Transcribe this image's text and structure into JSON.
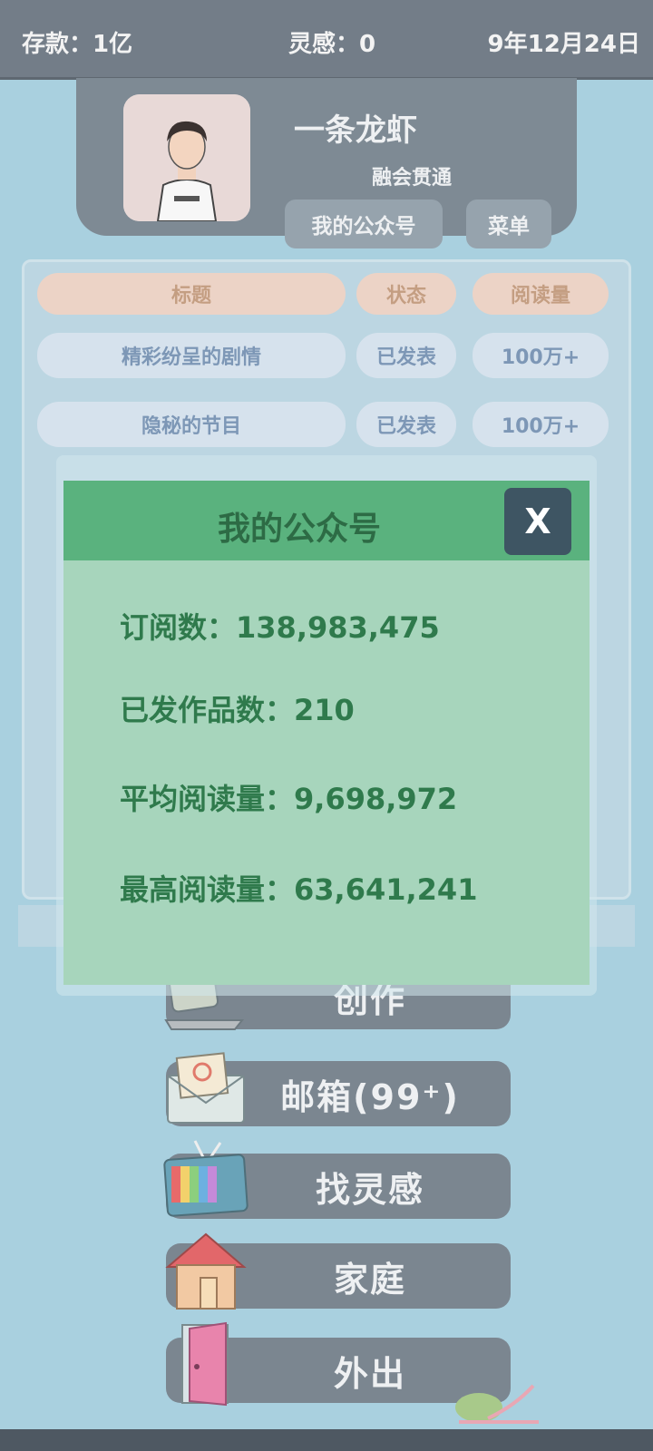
{
  "topbar": {
    "money_label": "存款：",
    "money_value": "1亿",
    "inspiration_label": "灵感：",
    "inspiration_value": "0",
    "date": "9年12月24日"
  },
  "profile": {
    "name": "一条龙虾",
    "title": "融会贯通",
    "public_account_button": "我的公众号",
    "menu_button": "菜单"
  },
  "table": {
    "headers": [
      "标题",
      "状态",
      "阅读量"
    ],
    "rows": [
      {
        "title": "精彩纷呈的剧情",
        "status": "已发表",
        "reads": "100万+"
      },
      {
        "title": "隐秘的节目",
        "status": "已发表",
        "reads": "100万+"
      }
    ]
  },
  "nav": {
    "create": "创作",
    "mailbox": "邮箱(99⁺)",
    "find_inspiration": "找灵感",
    "family": "家庭",
    "go_out": "外出"
  },
  "modal": {
    "title": "我的公众号",
    "close_label": "X",
    "subscribers_label": "订阅数：",
    "subscribers_value": "138,983,475",
    "published_label": "已发作品数：",
    "published_value": "210",
    "avg_reads_label": "平均阅读量：",
    "avg_reads_value": "9,698,972",
    "max_reads_label": "最高阅读量：",
    "max_reads_value": "63,641,241"
  },
  "colors": {
    "background": "#a9d0df",
    "topbar": "#737d88",
    "modal_body": "#a7d5bc",
    "modal_header": "#5ab27e",
    "modal_text": "#2f7a4c",
    "close_button": "#3e5563"
  }
}
